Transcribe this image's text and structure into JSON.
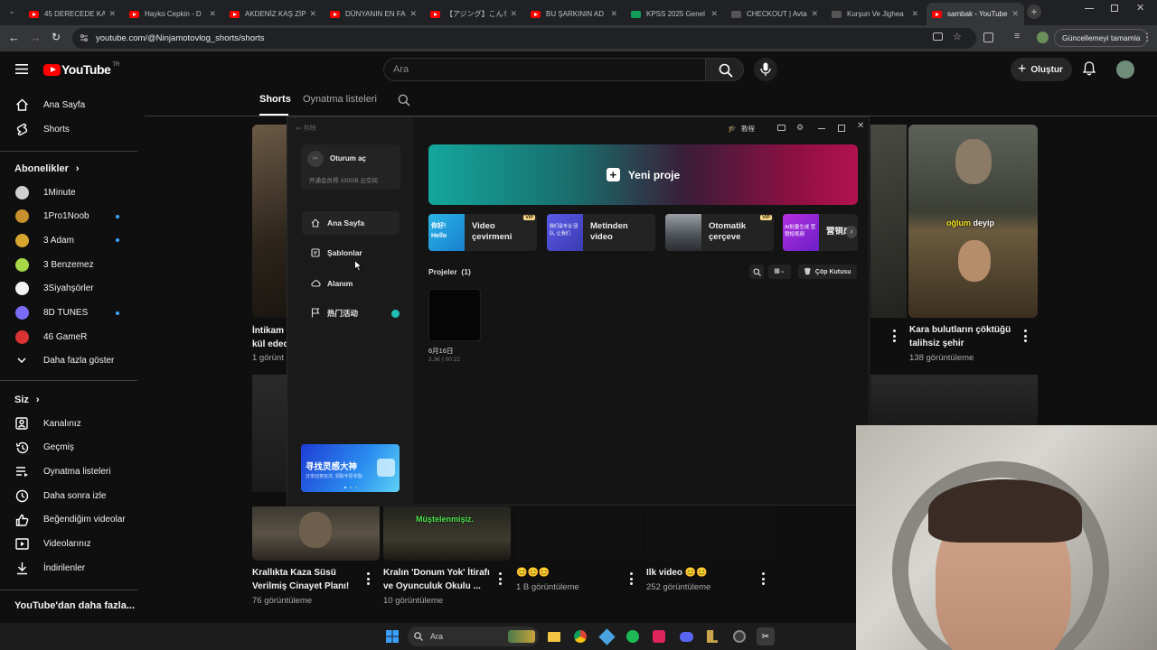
{
  "browser": {
    "tabs": [
      {
        "title": "45 DERECEDE KA",
        "icon": "youtube-icon"
      },
      {
        "title": "Hayko Cepkin - D",
        "icon": "youtube-icon"
      },
      {
        "title": "AKDENİZ KAŞ ZİP",
        "icon": "youtube-icon"
      },
      {
        "title": "DÜNYANIN EN FA",
        "icon": "youtube-icon"
      },
      {
        "title": "【アジング】こんな小",
        "icon": "youtube-icon"
      },
      {
        "title": "BU ŞARKININ AD",
        "icon": "youtube-icon"
      },
      {
        "title": "KPSS 2025 Genel",
        "icon": "sheets-icon"
      },
      {
        "title": "CHECKOUT | Avta",
        "icon": "page-icon"
      },
      {
        "title": "Kurşun Ve Jighea",
        "icon": "page-icon"
      },
      {
        "title": "sambak - YouTube",
        "icon": "youtube-icon",
        "active": true
      }
    ],
    "url": "youtube.com/@Ninjamotovlog_shorts/shorts",
    "update_label": "Güncellemeyi tamamla"
  },
  "youtube": {
    "logo_text": "YouTube",
    "country_code": "TR",
    "search_placeholder": "Ara",
    "create_label": "Oluştur",
    "channel_tabs": [
      {
        "label": "Shorts",
        "active": true
      },
      {
        "label": "Oynatma listeleri",
        "active": false
      }
    ],
    "sidebar": {
      "main": [
        {
          "label": "Ana Sayfa",
          "icon": "home-icon"
        },
        {
          "label": "Shorts",
          "icon": "shorts-icon"
        }
      ],
      "subscriptions_title": "Abonelikler",
      "subscriptions": [
        {
          "label": "1Minute",
          "color": "#cfcfcf",
          "new": false
        },
        {
          "label": "1Pro1Noob",
          "color": "#c8912d",
          "new": true
        },
        {
          "label": "3 Adam",
          "color": "#d9a531",
          "new": true
        },
        {
          "label": "3 Benzemez",
          "color": "#a7d84a",
          "new": false
        },
        {
          "label": "3Siyahşörler",
          "color": "#f2f2f2",
          "new": false
        },
        {
          "label": "8D TUNES",
          "color": "#7b6cf5",
          "new": true
        },
        {
          "label": "46 GameR",
          "color": "#d93333",
          "new": false
        }
      ],
      "show_more": "Daha fazla göster",
      "you_title": "Siz",
      "you_items": [
        {
          "label": "Kanalınız",
          "icon": "channel-icon"
        },
        {
          "label": "Geçmiş",
          "icon": "history-icon"
        },
        {
          "label": "Oynatma listeleri",
          "icon": "playlist-icon"
        },
        {
          "label": "Daha sonra izle",
          "icon": "clock-icon"
        },
        {
          "label": "Beğendiğim videolar",
          "icon": "like-icon"
        },
        {
          "label": "Videolarınız",
          "icon": "video-icon"
        },
        {
          "label": "İndirilenler",
          "icon": "download-icon"
        }
      ],
      "more_title": "YouTube'dan daha fazla..."
    },
    "shorts_row1": [
      {
        "title_line1": "İntikam",
        "title_line2": "kül eded",
        "views": "1 görünt"
      },
      {
        "title_line1": "Kara bulutların çöktüğü",
        "title_line2": "talihsiz şehir",
        "views": "138 görüntüleme",
        "overlay": "oğlum deyip",
        "overlay_highlight": "oğlum"
      }
    ],
    "shorts_row2": [
      {
        "title_line1": "Krallıkta Kaza Süsü",
        "title_line2": "Verilmiş Cinayet Planı!",
        "views": "76 görüntüleme"
      },
      {
        "title_line1": "Kralın 'Donum Yok' İtirafı",
        "title_line2": "ve Oyunculuk Okulu ...",
        "views": "10 görüntüleme",
        "overlay": "Müştelenmişiz."
      },
      {
        "title_line1": "😊😊😊",
        "title_line2": "",
        "views": "1 B görüntüleme"
      },
      {
        "title_line1": "Ilk video 😊😊",
        "title_line2": "",
        "views": "252 görüntüleme"
      }
    ]
  },
  "capcut": {
    "app_logo": "剪映",
    "tutorial_label": "教程",
    "login_label": "Oturum aç",
    "promo_text": "开通会员得 100GB 云空间",
    "nav": [
      {
        "label": "Ana Sayfa",
        "icon": "home-icon",
        "active": true
      },
      {
        "label": "Şablonlar",
        "icon": "template-icon",
        "active": false
      },
      {
        "label": "Alanım",
        "icon": "cloud-icon",
        "active": false
      },
      {
        "label": "热门活动",
        "icon": "flag-icon",
        "active": false
      }
    ],
    "banner_title": "寻找灵感大神",
    "banner_sub": "分享创意玩法, 领取丰厚奖励",
    "new_project_label": "Yeni proje",
    "tools": [
      {
        "label_line1": "Video",
        "label_line2": "çevirmeni",
        "vip": "VIP",
        "thumb_text": "你好! Hello"
      },
      {
        "label_line1": "Metinden",
        "label_line2": "video",
        "vip": "",
        "thumb_text": "我们是专业 团队, 让我们"
      },
      {
        "label_line1": "Otomatik",
        "label_line2": "çerçeve",
        "vip": "VIP",
        "thumb_text": ""
      },
      {
        "label_line1": "营销成",
        "label_line2": "",
        "vip": "",
        "thumb_text": "AI批量生成 营销短视频"
      }
    ],
    "projects_label": "Projeler",
    "projects_count": "(1)",
    "trash_label": "Çöp Kutusu",
    "project": {
      "date": "6月16日",
      "meta": "3.3K | 00:22"
    }
  },
  "taskbar": {
    "search_placeholder": "Ara"
  }
}
